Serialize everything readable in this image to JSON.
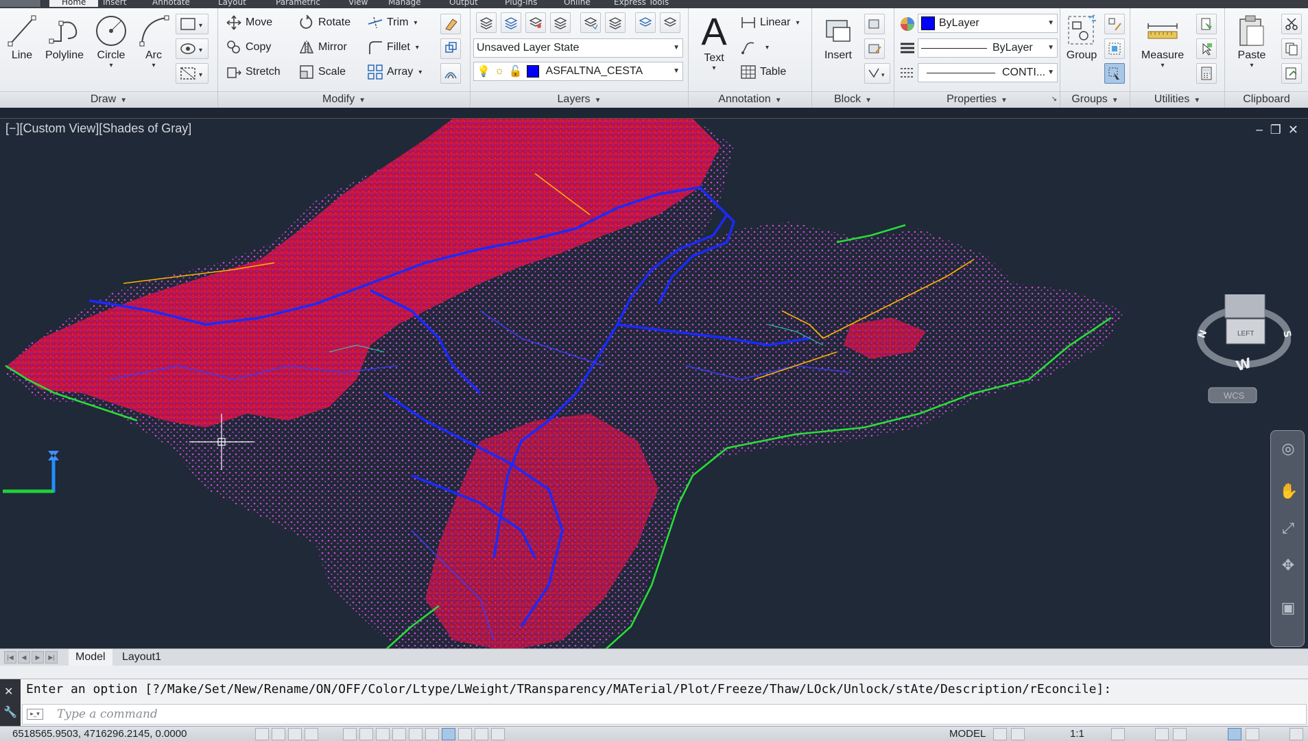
{
  "ribbon_tabs": [
    "Home",
    "Insert",
    "Annotate",
    "Layout",
    "Parametric",
    "View",
    "Manage",
    "Output",
    "Plug-ins",
    "Online",
    "Express Tools"
  ],
  "draw": {
    "title": "Draw",
    "line": "Line",
    "polyline": "Polyline",
    "circle": "Circle",
    "arc": "Arc"
  },
  "modify": {
    "title": "Modify",
    "move": "Move",
    "rotate": "Rotate",
    "trim": "Trim",
    "copy": "Copy",
    "mirror": "Mirror",
    "fillet": "Fillet",
    "stretch": "Stretch",
    "scale": "Scale",
    "array": "Array"
  },
  "layers": {
    "title": "Layers",
    "layer_state": "Unsaved Layer State",
    "current_layer": "ASFALTNA_CESTA",
    "layer_color": "#0000ff"
  },
  "annotation": {
    "title": "Annotation",
    "text": "Text",
    "linear": "Linear",
    "table": "Table"
  },
  "block": {
    "title": "Block",
    "insert": "Insert"
  },
  "properties": {
    "title": "Properties",
    "color": "ByLayer",
    "lineweight": "ByLayer",
    "linetype": "CONTI..."
  },
  "groups": {
    "title": "Groups",
    "group": "Group"
  },
  "utilities": {
    "title": "Utilities",
    "measure": "Measure"
  },
  "clipboard": {
    "title": "Clipboard",
    "paste": "Paste"
  },
  "viewport": {
    "label": "[−][Custom View][Shades of Gray]",
    "viewcube_face": "LEFT",
    "compass": {
      "n": "N",
      "s": "S",
      "w": "W"
    },
    "wcs": "WCS"
  },
  "layout_tabs": [
    "Model",
    "Layout1"
  ],
  "command": {
    "history": "Enter an option [?/Make/Set/New/Rename/ON/OFF/Color/Ltype/LWeight/TRansparency/MATerial/Plot/Freeze/Thaw/LOck/Unlock/stAte/Description/rEconcile]:",
    "placeholder": "Type a command"
  },
  "status": {
    "coords": "6518565.9503, 4716296.2145, 0.0000",
    "model": "MODEL",
    "scale": "1:1"
  }
}
